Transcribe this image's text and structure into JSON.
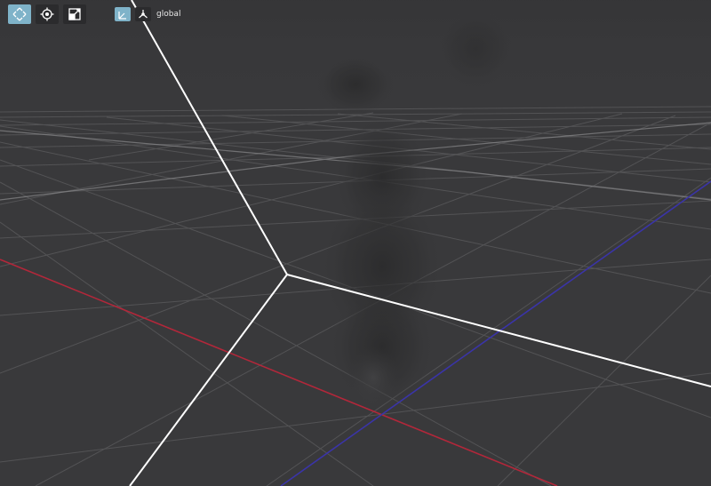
{
  "toolbar": {
    "tools": [
      {
        "id": "move",
        "icon": "move-icon",
        "active": true
      },
      {
        "id": "rotate",
        "icon": "rotate-icon",
        "active": false
      },
      {
        "id": "scale",
        "icon": "scale-icon",
        "active": false
      }
    ],
    "space": {
      "local_icon": "local-space-icon",
      "global_icon": "global-space-icon",
      "label": "global"
    }
  },
  "colors": {
    "background": "#39393b",
    "grid": "#5a5a5c",
    "x_axis": "#b2273a",
    "z_axis": "#3a34a8",
    "gizmo": "#ffffff",
    "active_button": "#7fb3c9",
    "button": "#2b2b2d"
  }
}
